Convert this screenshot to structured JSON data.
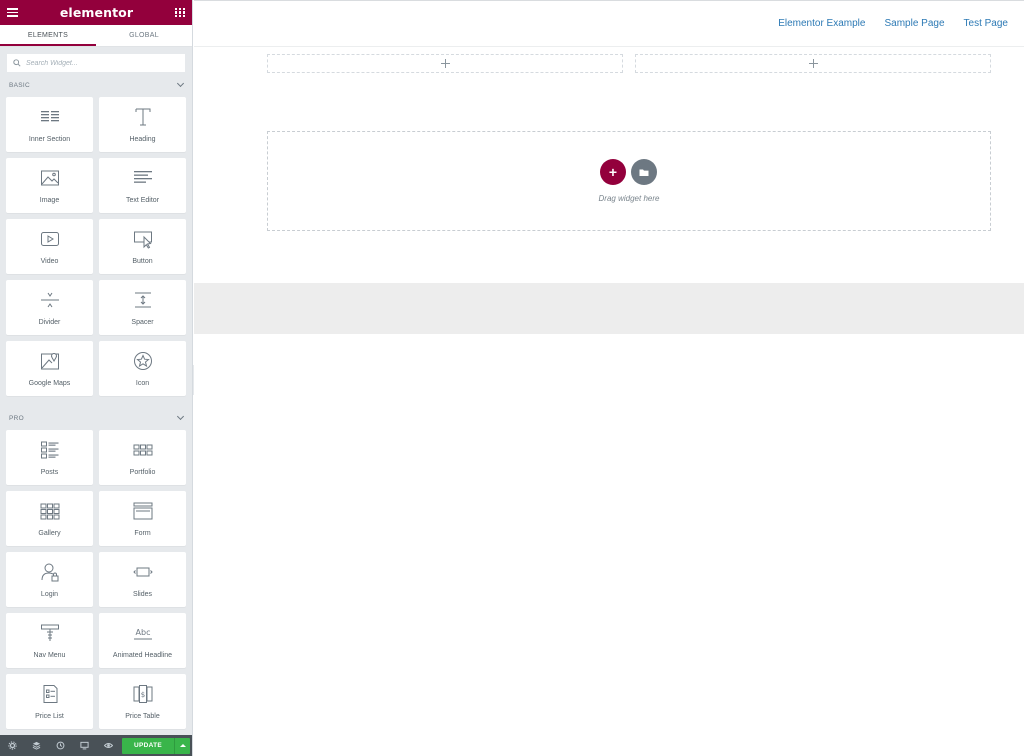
{
  "panel": {
    "logo": "elementor",
    "tabs": [
      "ELEMENTS",
      "GLOBAL"
    ],
    "search_placeholder": "Search Widget...",
    "basic_title": "BASIC",
    "pro_title": "PRO",
    "basic_widgets": [
      {
        "label": "Inner Section",
        "icon": "inner-section-icon"
      },
      {
        "label": "Heading",
        "icon": "heading-icon"
      },
      {
        "label": "Image",
        "icon": "image-icon"
      },
      {
        "label": "Text Editor",
        "icon": "text-editor-icon"
      },
      {
        "label": "Video",
        "icon": "video-icon"
      },
      {
        "label": "Button",
        "icon": "button-icon"
      },
      {
        "label": "Divider",
        "icon": "divider-icon"
      },
      {
        "label": "Spacer",
        "icon": "spacer-icon"
      },
      {
        "label": "Google Maps",
        "icon": "google-maps-icon"
      },
      {
        "label": "Icon",
        "icon": "star-icon"
      }
    ],
    "pro_widgets": [
      {
        "label": "Posts",
        "icon": "posts-icon"
      },
      {
        "label": "Portfolio",
        "icon": "portfolio-icon"
      },
      {
        "label": "Gallery",
        "icon": "gallery-icon"
      },
      {
        "label": "Form",
        "icon": "form-icon"
      },
      {
        "label": "Login",
        "icon": "login-icon"
      },
      {
        "label": "Slides",
        "icon": "slides-icon"
      },
      {
        "label": "Nav Menu",
        "icon": "nav-menu-icon"
      },
      {
        "label": "Animated Headline",
        "icon": "animated-headline-icon"
      },
      {
        "label": "Price List",
        "icon": "price-list-icon"
      },
      {
        "label": "Price Table",
        "icon": "price-table-icon"
      }
    ],
    "footer": {
      "update_label": "UPDATE",
      "icons": [
        "settings-icon",
        "navigator-icon",
        "history-icon",
        "responsive-icon",
        "preview-eye-icon"
      ]
    }
  },
  "preview": {
    "nav": [
      "Elementor Example",
      "Sample Page",
      "Test Page"
    ],
    "drop_text": "Drag widget here"
  },
  "colors": {
    "brand": "#93003c",
    "update_green": "#39b54a",
    "nav_link": "#2d7ab5"
  }
}
